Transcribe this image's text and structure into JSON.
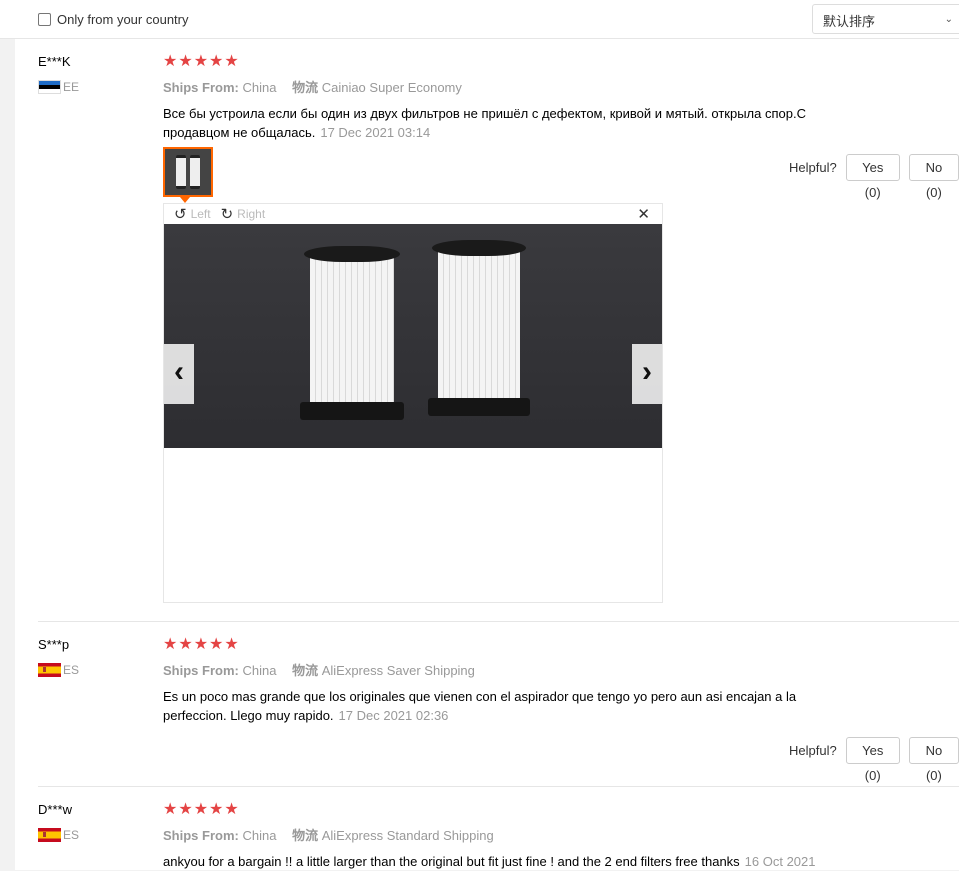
{
  "filter_bar": {
    "country_label": "Only from your country",
    "sort_value": "默认排序"
  },
  "labels": {
    "ships_from": "Ships From:",
    "logistics": "物流",
    "helpful": "Helpful?",
    "rotate_left": "Left",
    "rotate_right": "Right"
  },
  "reviews": [
    {
      "user": "E***K",
      "country_code": "EE",
      "stars": "★★★★★",
      "ships_from": "China",
      "shipping": "Cainiao Super Economy",
      "text": "Все бы устроила если бы один из двух фильтров не пришёл с дефектом, кривой и мятый. открыла спор.С продавцом не общалась.",
      "date": "17 Dec 2021 03:14",
      "yes": "Yes (0)",
      "no": "No (0)"
    },
    {
      "user": "S***p",
      "country_code": "ES",
      "stars": "★★★★★",
      "ships_from": "China",
      "shipping": "AliExpress Saver Shipping",
      "text": "Es un poco mas grande que los originales que vienen con el aspirador que tengo yo pero aun asi encajan a la perfeccion. Llego muy rapido.",
      "date": "17 Dec 2021 02:36",
      "yes": "Yes (0)",
      "no": "No (0)"
    },
    {
      "user": "D***w",
      "country_code": "ES",
      "stars": "★★★★★",
      "ships_from": "China",
      "shipping": "AliExpress Standard Shipping",
      "text": "ankyou for a bargain !! a little larger than the original but fit just fine ! and the 2 end filters free thanks",
      "date": "16 Oct 2021"
    }
  ],
  "colors": {
    "star": "#e44444",
    "accent": "#ff6600"
  }
}
